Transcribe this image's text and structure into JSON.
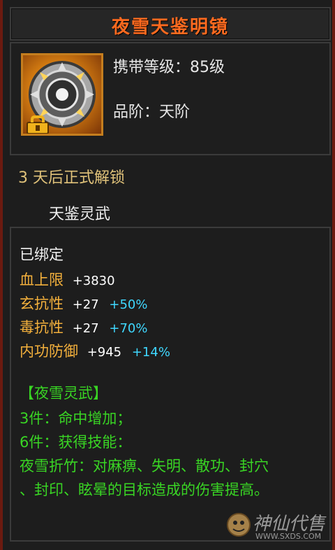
{
  "item": {
    "title": "夜雪天鉴明镜",
    "level_line": "携带等级：85级",
    "rank_line": "品阶：天阶",
    "unlock_text": "3 天后正式解锁",
    "sub_title": "天鉴灵武"
  },
  "stats": {
    "bound": "已绑定",
    "lines": [
      {
        "label": "血上限",
        "value": "+3830",
        "extra": ""
      },
      {
        "label": "玄抗性",
        "value": "+27",
        "extra": "+50%"
      },
      {
        "label": "毒抗性",
        "value": "+27",
        "extra": "+70%"
      },
      {
        "label": "内功防御",
        "value": "+945",
        "extra": "+14%"
      }
    ]
  },
  "set": {
    "name": "【夜雪灵武】",
    "bonus3": "3件：命中增加；",
    "bonus6": "6件：获得技能：",
    "skill_line1": "夜雪折竹：对麻痹、失明、散功、封穴",
    "skill_line2": "、封印、眩晕的目标造成的伤害提高。"
  },
  "watermark": {
    "text": "神仙代售",
    "url": "WWW.SXDS.COM"
  },
  "colors": {
    "title": "#ff6a1f",
    "stat_label": "#f3b03c",
    "bonus_percent": "#3fd8ff",
    "set_text": "#39d524",
    "unlock_text": "#e0c27a",
    "frame_red": "#6b1a10"
  },
  "icons": {
    "item": "mirror-wheel-icon",
    "badge": "bound-lock-icon",
    "watermark": "sxds-logo-icon"
  }
}
